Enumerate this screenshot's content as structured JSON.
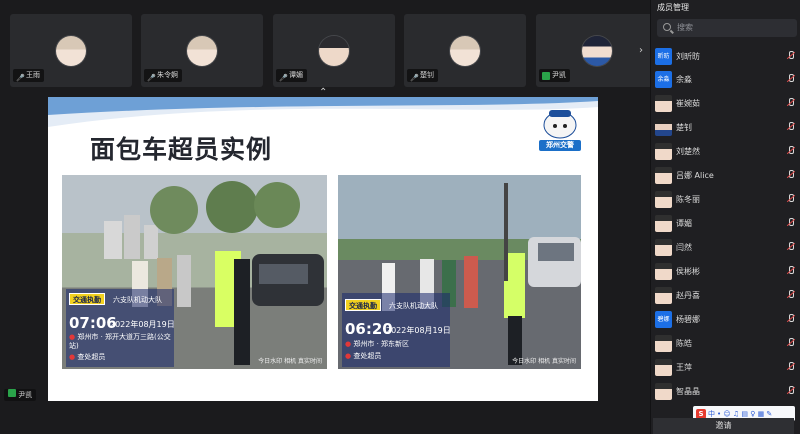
{
  "video_tiles": [
    {
      "name": "王雨",
      "face": "face"
    },
    {
      "name": "朱令婀",
      "face": "face"
    },
    {
      "name": "谭媚",
      "face": "dark"
    },
    {
      "name": "楚钊",
      "face": "face"
    },
    {
      "name": "尹凯",
      "face": "blue"
    }
  ],
  "slide": {
    "title": "面包车超员实例",
    "logo_text": "郑州交警",
    "photos": [
      {
        "tag": "交通执勤",
        "unit": "六支队机动大队",
        "time": "07:06",
        "date": "2022年08月19日",
        "location": "郑州市 · 郑开大道万三路(公交站)",
        "action": "查处超员",
        "watermark": "今日水印 相机 真实时间"
      },
      {
        "tag": "交通执勤",
        "unit": "六支队机动大队",
        "time": "06:20",
        "date": "2022年08月19日",
        "location": "郑州市 · 郑东新区",
        "action": "查处超员",
        "watermark": "今日水印 相机 真实时间"
      }
    ]
  },
  "panel": {
    "title": "成员管理",
    "search_placeholder": "搜索",
    "members": [
      {
        "name": "刘昕昉",
        "avatar": "昕昉",
        "type": "text"
      },
      {
        "name": "余淼",
        "avatar": "余淼",
        "type": "text"
      },
      {
        "name": "崔婉茹",
        "avatar": "",
        "type": "photo"
      },
      {
        "name": "楚钊",
        "avatar": "",
        "type": "photo"
      },
      {
        "name": "刘楚然",
        "avatar": "",
        "type": "photo"
      },
      {
        "name": "吕娜 Alice",
        "avatar": "",
        "type": "photo"
      },
      {
        "name": "陈冬丽",
        "avatar": "",
        "type": "photo"
      },
      {
        "name": "谭媚",
        "avatar": "",
        "type": "photo"
      },
      {
        "name": "闫然",
        "avatar": "",
        "type": "photo"
      },
      {
        "name": "侯彬彬",
        "avatar": "",
        "type": "photo"
      },
      {
        "name": "赵丹喜",
        "avatar": "",
        "type": "photo"
      },
      {
        "name": "杨碧娜",
        "avatar": "碧娜",
        "type": "text"
      },
      {
        "name": "陈皓",
        "avatar": "",
        "type": "photo"
      },
      {
        "name": "王萍",
        "avatar": "",
        "type": "photo"
      },
      {
        "name": "智晶晶",
        "avatar": "",
        "type": "photo"
      }
    ]
  },
  "local_user": "尹凯",
  "ime_label": "中",
  "invite_label": "邀请"
}
